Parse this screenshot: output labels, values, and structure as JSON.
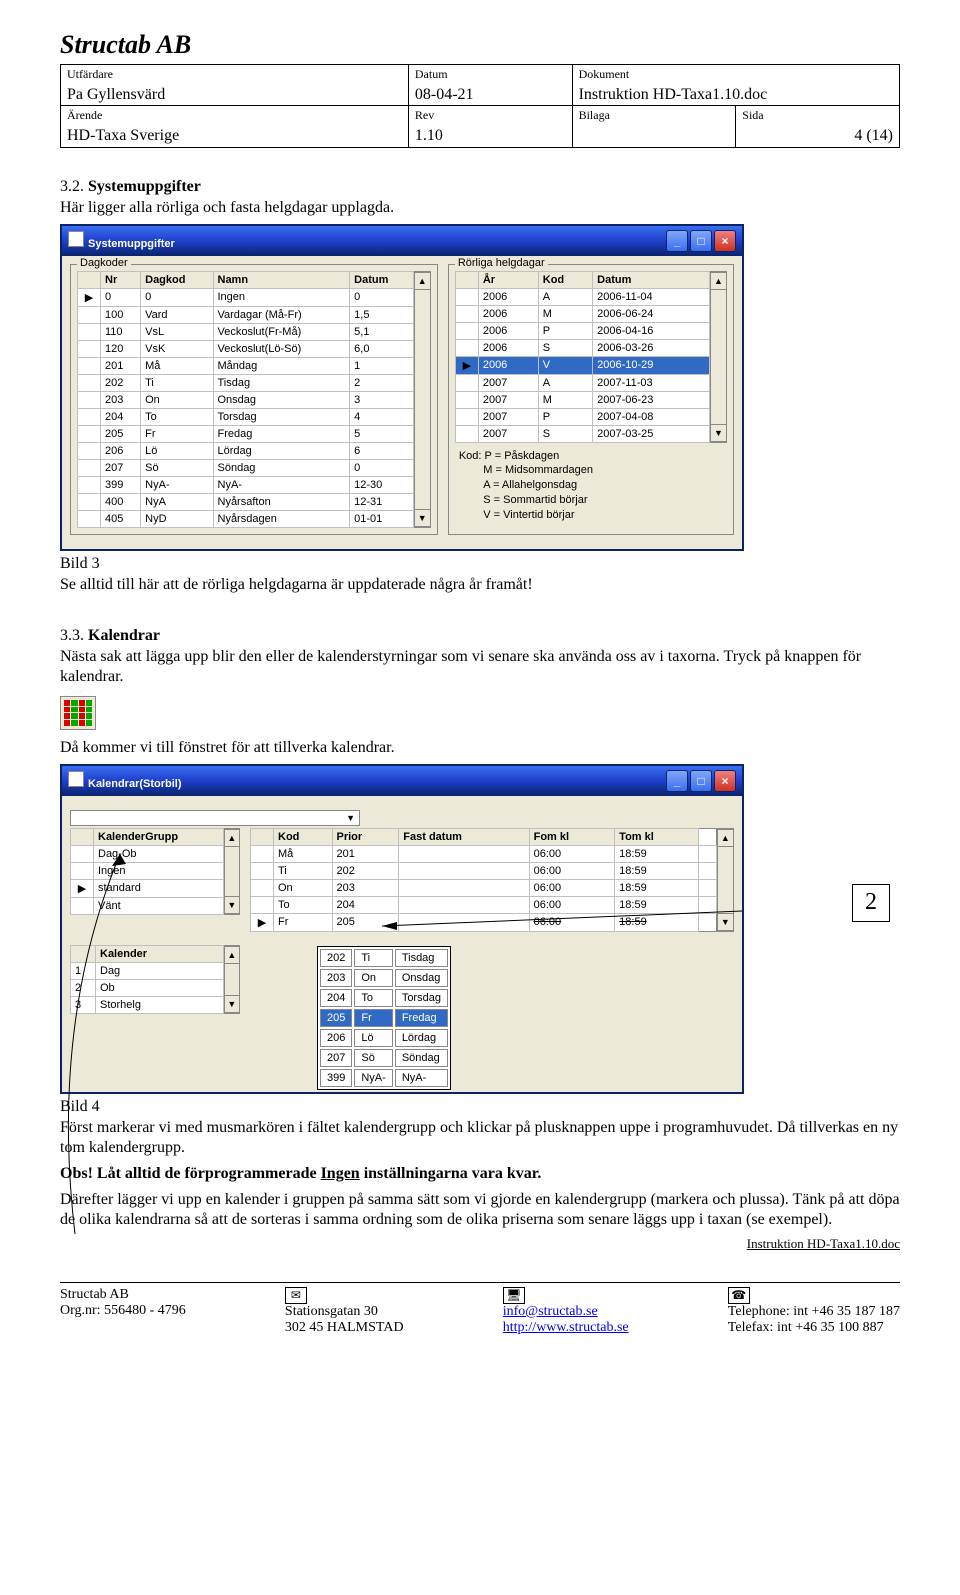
{
  "header": {
    "company": "Structab AB",
    "utfardare_label": "Utfärdare",
    "utfardare": "Pa Gyllensvärd",
    "datum_label": "Datum",
    "datum": "08-04-21",
    "dokument_label": "Dokument",
    "dokument": "Instruktion HD-Taxa1.10.doc",
    "arende_label": "Ärende",
    "arende": "HD-Taxa Sverige",
    "rev_label": "Rev",
    "rev": "1.10",
    "bilaga_label": "Bilaga",
    "bilaga": "",
    "sida_label": "Sida",
    "sida": "4 (14)"
  },
  "section32": {
    "num": "3.2.",
    "title": "Systemuppgifter",
    "intro": "Här ligger alla rörliga och fasta helgdagar upplagda."
  },
  "win1": {
    "title": "Systemuppgifter",
    "group_left": "Dagkoder",
    "group_right": "Rörliga helgdagar",
    "left_headers": [
      "",
      "Nr",
      "Dagkod",
      "Namn",
      "Datum"
    ],
    "left_rows": [
      [
        "▶",
        "0",
        "0",
        "Ingen",
        "0"
      ],
      [
        "",
        "100",
        "Vard",
        "Vardagar (Må-Fr)",
        "1,5"
      ],
      [
        "",
        "110",
        "VsL",
        "Veckoslut(Fr-Må)",
        "5,1"
      ],
      [
        "",
        "120",
        "VsK",
        "Veckoslut(Lö-Sö)",
        "6,0"
      ],
      [
        "",
        "201",
        "Må",
        "Måndag",
        "1"
      ],
      [
        "",
        "202",
        "Ti",
        "Tisdag",
        "2"
      ],
      [
        "",
        "203",
        "On",
        "Onsdag",
        "3"
      ],
      [
        "",
        "204",
        "To",
        "Torsdag",
        "4"
      ],
      [
        "",
        "205",
        "Fr",
        "Fredag",
        "5"
      ],
      [
        "",
        "206",
        "Lö",
        "Lördag",
        "6"
      ],
      [
        "",
        "207",
        "Sö",
        "Söndag",
        "0"
      ],
      [
        "",
        "399",
        "NyA-",
        "NyA-",
        "12-30"
      ],
      [
        "",
        "400",
        "NyA",
        "Nyårsafton",
        "12-31"
      ],
      [
        "",
        "405",
        "NyD",
        "Nyårsdagen",
        "01-01"
      ]
    ],
    "right_headers": [
      "",
      "År",
      "Kod",
      "Datum"
    ],
    "right_rows": [
      [
        "",
        "2006",
        "A",
        "2006-11-04"
      ],
      [
        "",
        "2006",
        "M",
        "2006-06-24"
      ],
      [
        "",
        "2006",
        "P",
        "2006-04-16"
      ],
      [
        "",
        "2006",
        "S",
        "2006-03-26"
      ],
      [
        "▶",
        "2006",
        "V",
        "2006-10-29"
      ],
      [
        "",
        "2007",
        "A",
        "2007-11-03"
      ],
      [
        "",
        "2007",
        "M",
        "2007-06-23"
      ],
      [
        "",
        "2007",
        "P",
        "2007-04-08"
      ],
      [
        "",
        "2007",
        "S",
        "2007-03-25"
      ]
    ],
    "legend_label": "Kod:",
    "legend": [
      "P = Påskdagen",
      "M = Midsommardagen",
      "A = Allahelgonsdag",
      "S = Sommartid börjar",
      "V = Vintertid börjar"
    ]
  },
  "bild3": {
    "caption": "Bild 3",
    "text": "Se alltid till här att de rörliga helgdagarna är uppdaterade några år framåt!"
  },
  "section33": {
    "num": "3.3.",
    "title": "Kalendrar",
    "p1": "Nästa sak att lägga upp blir den eller de kalenderstyrningar som vi senare ska använda oss av i taxorna. Tryck på knappen för kalendrar.",
    "p2": "Då kommer vi till fönstret för att tillverka kalendrar."
  },
  "win2": {
    "title": "Kalendrar(Storbil)",
    "dropdown_value": "",
    "kg_header": "KalenderGrupp",
    "kg_rows": [
      [
        "",
        "Dag-Ob"
      ],
      [
        "",
        "Ingen"
      ],
      [
        "▶",
        "standard"
      ],
      [
        "",
        "Vänt"
      ]
    ],
    "kal_header": "Kalender",
    "kal_rows": [
      [
        "1",
        "Dag"
      ],
      [
        "2",
        "Ob"
      ],
      [
        "3",
        "Storhelg"
      ]
    ],
    "right_headers": [
      "",
      "Kod",
      "Prior",
      "Fast datum",
      "Fom kl",
      "Tom kl"
    ],
    "right_rows": [
      [
        "",
        "Må",
        "201",
        "",
        "06:00",
        "18:59",
        ""
      ],
      [
        "",
        "Ti",
        "202",
        "",
        "06:00",
        "18:59",
        ""
      ],
      [
        "",
        "On",
        "203",
        "",
        "06:00",
        "18:59",
        ""
      ],
      [
        "",
        "To",
        "204",
        "",
        "06:00",
        "18:59",
        ""
      ],
      [
        "▶",
        "Fr",
        "205",
        "",
        "06:00",
        "18:59",
        "strike"
      ]
    ],
    "popup": [
      [
        "202",
        "Ti",
        "Tisdag",
        ""
      ],
      [
        "203",
        "On",
        "Onsdag",
        ""
      ],
      [
        "204",
        "To",
        "Torsdag",
        ""
      ],
      [
        "205",
        "Fr",
        "Fredag",
        "sel"
      ],
      [
        "206",
        "Lö",
        "Lördag",
        ""
      ],
      [
        "207",
        "Sö",
        "Söndag",
        ""
      ],
      [
        "399",
        "NyA-",
        "NyA-",
        ""
      ]
    ],
    "annotation": "2"
  },
  "bild4": {
    "caption": "Bild 4",
    "p1": "Först markerar vi med musmarkören i fältet kalendergrupp och klickar på plusknappen uppe i programhuvudet. Då tillverkas en ny tom kalendergrupp.",
    "p2a": "Obs! Låt alltid de förprogrammerade ",
    "p2u": "Ingen",
    "p2b": " inställningarna vara kvar.",
    "p3": "Därefter lägger vi upp en kalender i gruppen på samma sätt som vi gjorde en kalendergrupp (markera och plussa). Tänk på att döpa de olika kalendrarna så att de sorteras i samma ordning som de olika priserna som senare läggs upp i taxan (se exempel)."
  },
  "footer": {
    "doc": "Instruktion HD-Taxa1.10.doc",
    "c1a": "Structab AB",
    "c1b": "Org.nr: 556480 - 4796",
    "c2a": "Stationsgatan 30",
    "c2b": "302 45 HALMSTAD",
    "c3a": "info@structab.se",
    "c3b": "http://www.structab.se",
    "c4a_l": "Telephone:",
    "c4a_v": "int +46 35 187 187",
    "c4b_l": "Telefax:",
    "c4b_v": "int +46 35 100 887"
  }
}
